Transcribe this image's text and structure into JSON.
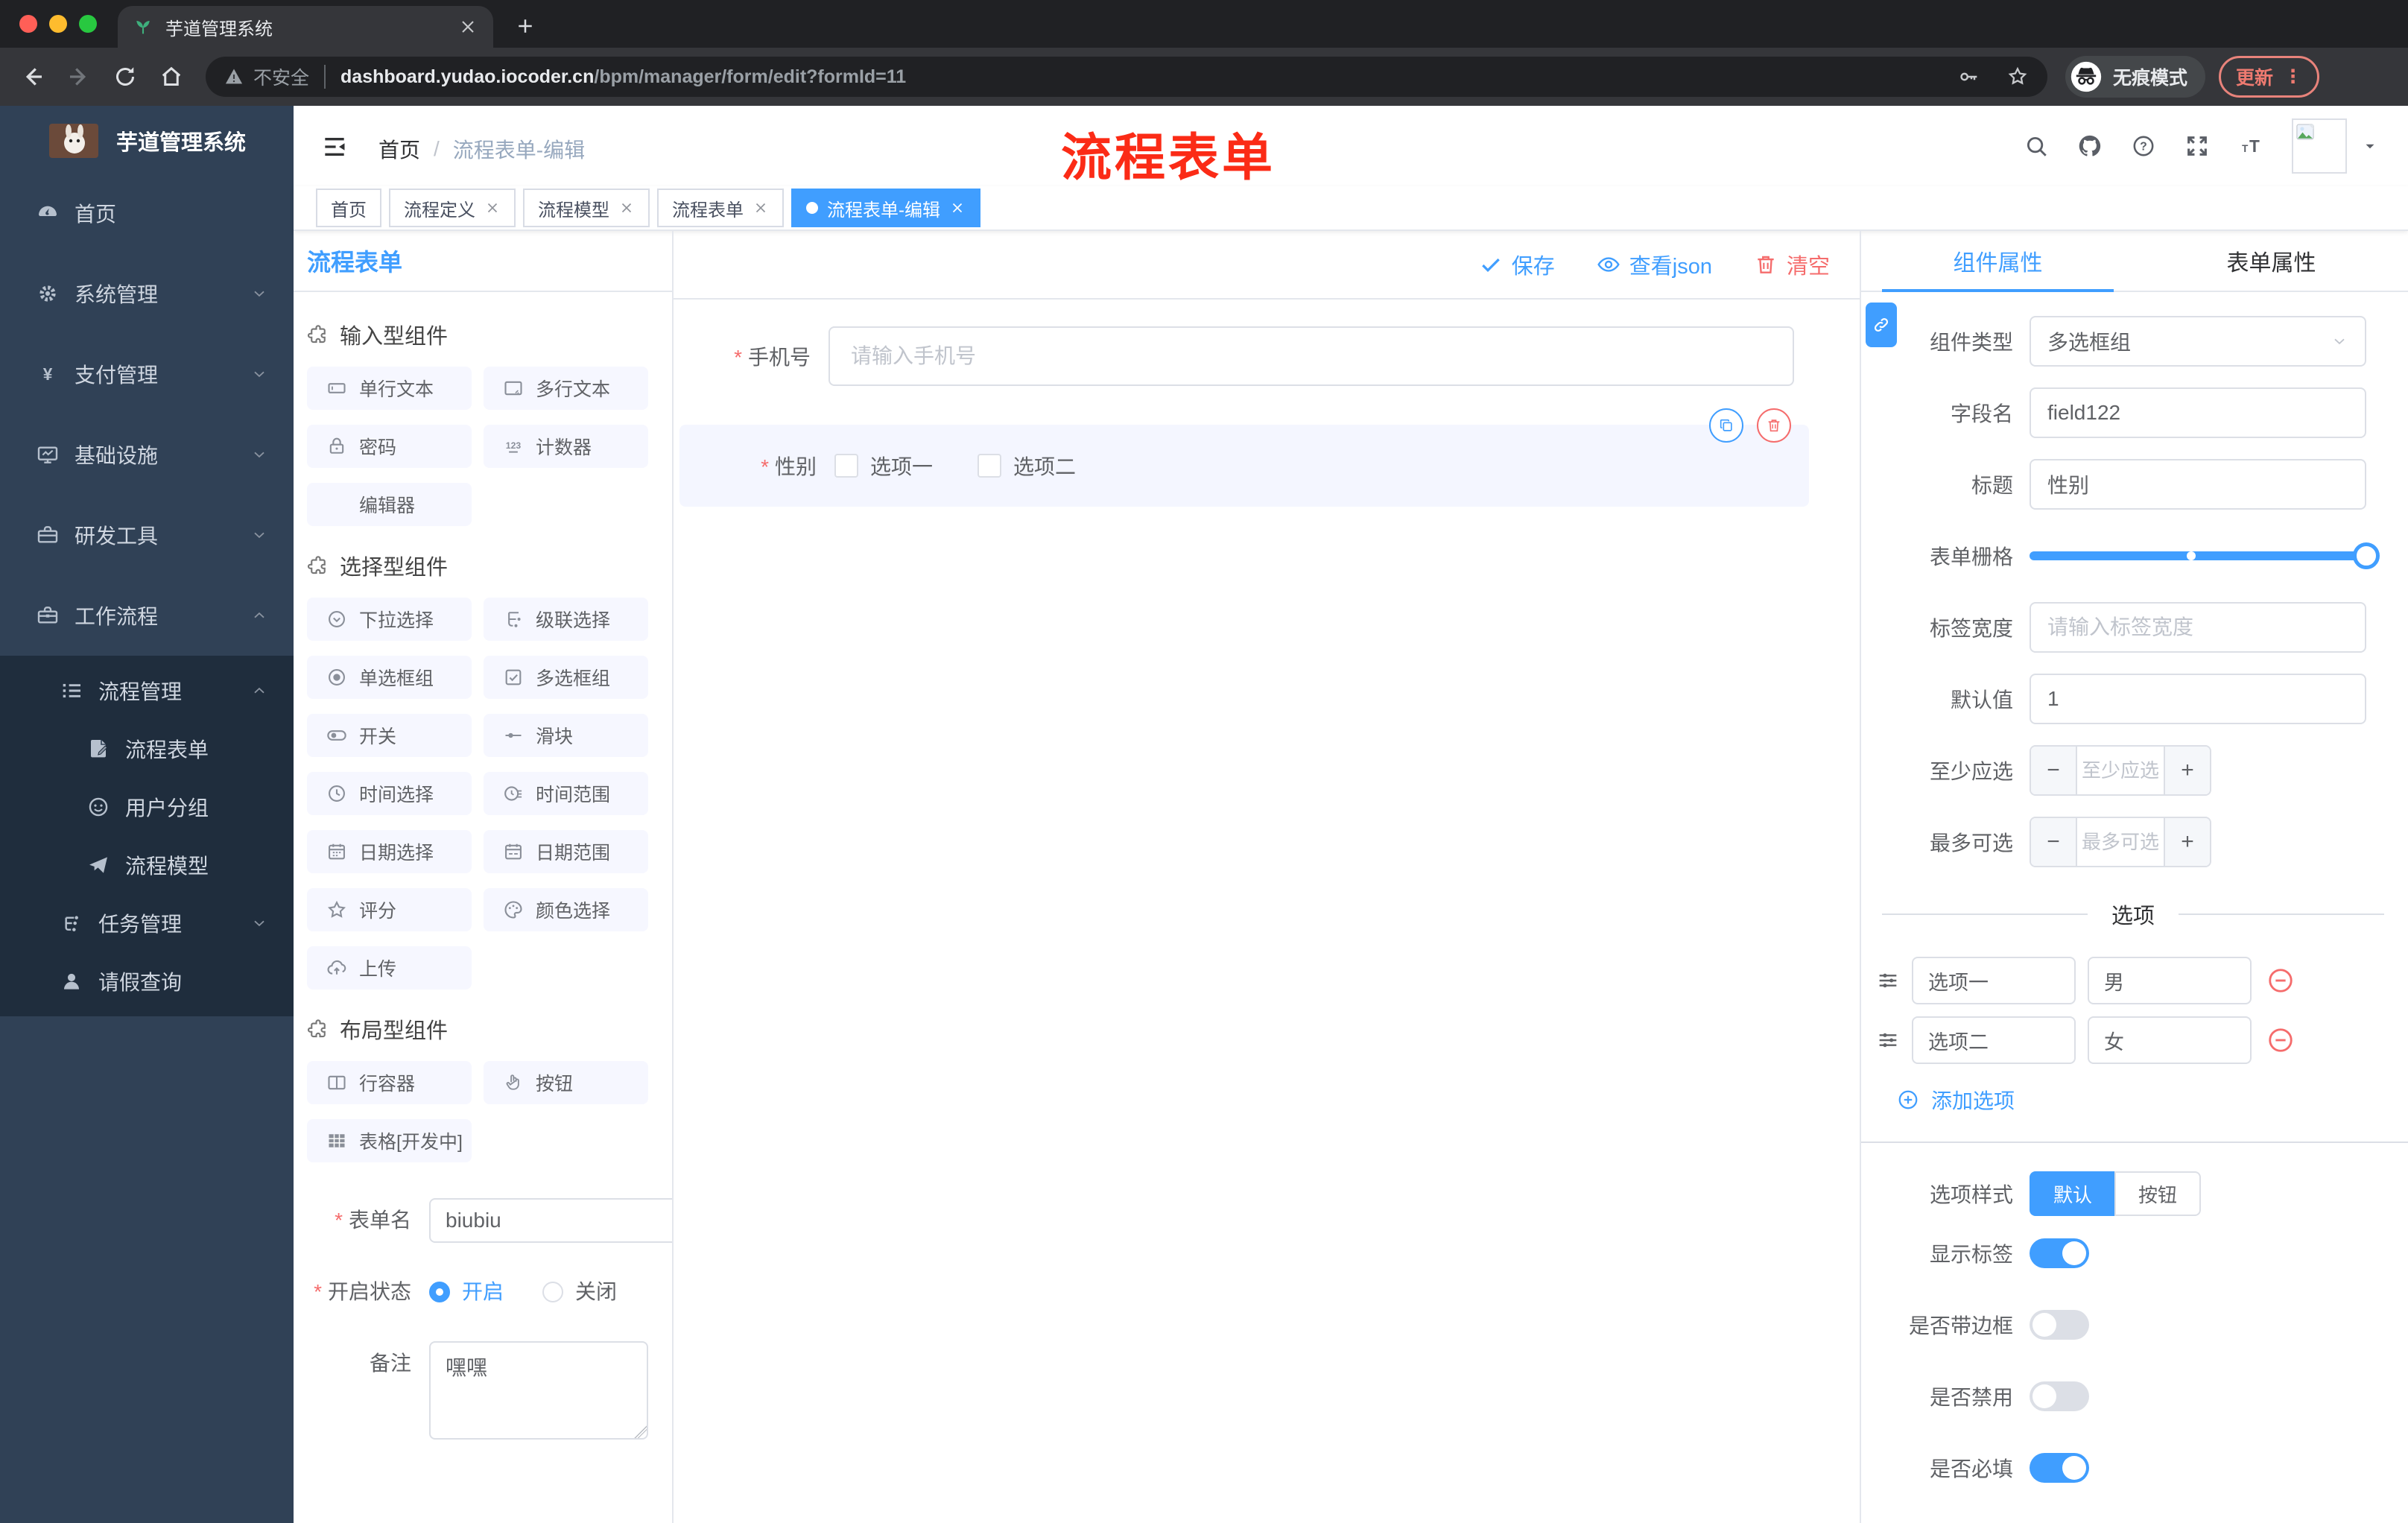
{
  "browser": {
    "tab_title": "芋道管理系统",
    "security_label": "不安全",
    "url_domain": "dashboard.yudao.iocoder.cn",
    "url_path": "/bpm/manager/form/edit?formId=11",
    "incognito_label": "无痕模式",
    "update_label": "更新"
  },
  "sidebar": {
    "brand": "芋道管理系统",
    "menu": [
      {
        "label": "首页",
        "icon": "dashboard-icon",
        "chevron": null
      },
      {
        "label": "系统管理",
        "icon": "gear-icon",
        "chevron": "down"
      },
      {
        "label": "支付管理",
        "icon": "yen-icon",
        "chevron": "down"
      },
      {
        "label": "基础设施",
        "icon": "monitor-icon",
        "chevron": "down"
      },
      {
        "label": "研发工具",
        "icon": "toolbox-icon",
        "chevron": "down"
      },
      {
        "label": "工作流程",
        "icon": "briefcase-icon",
        "chevron": "up"
      }
    ],
    "submenu": [
      {
        "label": "流程管理",
        "icon": "list-icon",
        "chevron": "up",
        "level": 2
      },
      {
        "label": "流程表单",
        "icon": "form-doc-icon",
        "chevron": null,
        "level": 3
      },
      {
        "label": "用户分组",
        "icon": "user-group-icon",
        "chevron": null,
        "level": 3
      },
      {
        "label": "流程模型",
        "icon": "paper-plane-icon",
        "chevron": null,
        "level": 3
      },
      {
        "label": "任务管理",
        "icon": "tree-icon",
        "chevron": "down",
        "level": 2
      },
      {
        "label": "请假查询",
        "icon": "user-icon",
        "chevron": null,
        "level": 2
      }
    ]
  },
  "header": {
    "breadcrumb": [
      "首页",
      "流程表单-编辑"
    ],
    "annotation": "流程表单",
    "annotation_color": "#FB2B16"
  },
  "tags": [
    {
      "label": "首页",
      "closable": false,
      "active": false
    },
    {
      "label": "流程定义",
      "closable": true,
      "active": false
    },
    {
      "label": "流程模型",
      "closable": true,
      "active": false
    },
    {
      "label": "流程表单",
      "closable": true,
      "active": false
    },
    {
      "label": "流程表单-编辑",
      "closable": true,
      "active": true
    }
  ],
  "palette": {
    "title": "流程表单",
    "sections": [
      {
        "title": "输入型组件",
        "icon": "puzzle-icon",
        "items": [
          {
            "label": "单行文本",
            "icon": "input-field-icon"
          },
          {
            "label": "多行文本",
            "icon": "textarea-icon"
          },
          {
            "label": "密码",
            "icon": "lock-icon"
          },
          {
            "label": "计数器",
            "icon": "counter-icon"
          },
          {
            "label": "编辑器",
            "icon": null
          }
        ]
      },
      {
        "title": "选择型组件",
        "icon": "puzzle-icon",
        "items": [
          {
            "label": "下拉选择",
            "icon": "select-icon"
          },
          {
            "label": "级联选择",
            "icon": "cascader-icon"
          },
          {
            "label": "单选框组",
            "icon": "radio-icon"
          },
          {
            "label": "多选框组",
            "icon": "checkbox-icon"
          },
          {
            "label": "开关",
            "icon": "switch-icon"
          },
          {
            "label": "滑块",
            "icon": "slider-icon"
          },
          {
            "label": "时间选择",
            "icon": "time-icon"
          },
          {
            "label": "时间范围",
            "icon": "time-range-icon"
          },
          {
            "label": "日期选择",
            "icon": "date-icon"
          },
          {
            "label": "日期范围",
            "icon": "date-range-icon"
          },
          {
            "label": "评分",
            "icon": "star-icon"
          },
          {
            "label": "颜色选择",
            "icon": "color-icon"
          },
          {
            "label": "上传",
            "icon": "upload-icon"
          }
        ]
      },
      {
        "title": "布局型组件",
        "icon": "puzzle-icon",
        "items": [
          {
            "label": "行容器",
            "icon": "row-icon"
          },
          {
            "label": "按钮",
            "icon": "hand-icon"
          },
          {
            "label": "表格[开发中]",
            "icon": "table-icon"
          }
        ]
      }
    ],
    "form": {
      "name_label": "表单名",
      "name_value": "biubiu",
      "status_label": "开启状态",
      "status_options": [
        {
          "label": "开启",
          "selected": true
        },
        {
          "label": "关闭",
          "selected": false
        }
      ],
      "remark_label": "备注",
      "remark_value": "嘿嘿"
    }
  },
  "canvas": {
    "toolbar": {
      "save": "保存",
      "view_json": "查看json",
      "clear": "清空"
    },
    "phone_field": {
      "label": "手机号",
      "required": true,
      "placeholder": "请输入手机号"
    },
    "gender_field": {
      "label": "性别",
      "required": true,
      "options": [
        "选项一",
        "选项二"
      ]
    }
  },
  "panel": {
    "tabs": [
      {
        "label": "组件属性",
        "active": true
      },
      {
        "label": "表单属性",
        "active": false
      }
    ],
    "component_type": {
      "label": "组件类型",
      "value": "多选框组"
    },
    "field_name": {
      "label": "字段名",
      "value": "field122"
    },
    "title_row": {
      "label": "标题",
      "value": "性别"
    },
    "grid_row": {
      "label": "表单栅格",
      "stop_percent": 48,
      "value_percent": 100
    },
    "label_width": {
      "label": "标签宽度",
      "placeholder": "请输入标签宽度"
    },
    "default_value": {
      "label": "默认值",
      "value": "1"
    },
    "min_select": {
      "label": "至少应选",
      "placeholder": "至少应选"
    },
    "max_select": {
      "label": "最多可选",
      "placeholder": "最多可选"
    },
    "options_title": "选项",
    "options": [
      {
        "name": "选项一",
        "value": "男"
      },
      {
        "name": "选项二",
        "value": "女"
      }
    ],
    "add_option": "添加选项",
    "option_style": {
      "label": "选项样式",
      "choices": [
        {
          "label": "默认",
          "active": true
        },
        {
          "label": "按钮",
          "active": false
        }
      ]
    },
    "toggles": [
      {
        "label": "显示标签",
        "on": true
      },
      {
        "label": "是否带边框",
        "on": false
      },
      {
        "label": "是否禁用",
        "on": false
      },
      {
        "label": "是否必填",
        "on": true
      }
    ]
  },
  "colors": {
    "accent": "#409EFF",
    "danger": "#F56C6C"
  }
}
